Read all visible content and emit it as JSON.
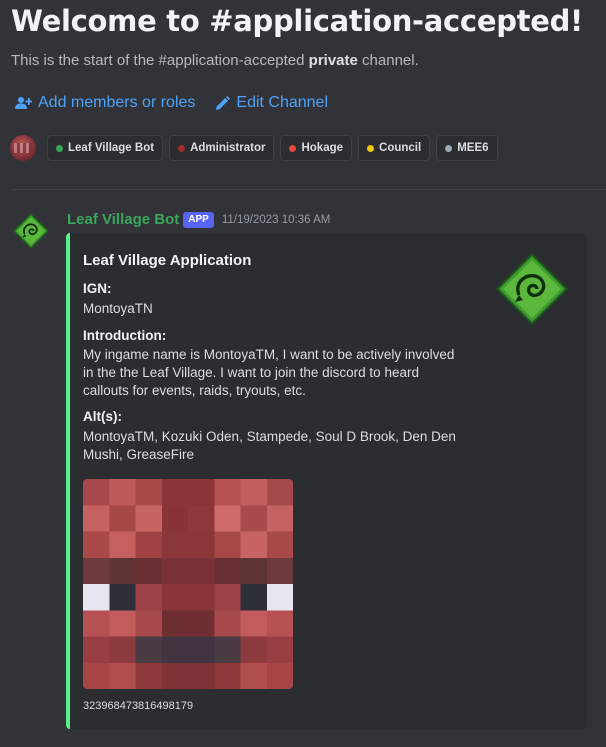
{
  "welcome": {
    "title": "Welcome to #application-accepted!",
    "subtitle_pre": "This is the start of the #application-accepted ",
    "subtitle_bold": "private",
    "subtitle_post": " channel."
  },
  "actions": {
    "add_members": "Add members or roles",
    "edit_channel": "Edit Channel"
  },
  "roles": [
    {
      "label": "Leaf Village Bot",
      "color": "#3ba55c"
    },
    {
      "label": "Administrator",
      "color": "#a12d2f"
    },
    {
      "label": "Hokage",
      "color": "#e34c3b"
    },
    {
      "label": "Council",
      "color": "#f1c40f"
    },
    {
      "label": "MEE6",
      "color": "#99aab5"
    }
  ],
  "message": {
    "author": "Leaf Village Bot",
    "badge": "APP",
    "timestamp": "11/19/2023 10:36 AM",
    "author_color": "#3ba55c",
    "embed": {
      "accent_color": "#57f287",
      "title": "Leaf Village Application",
      "fields": [
        {
          "name": "IGN:",
          "value": "MontoyaTN"
        },
        {
          "name": "Introduction:",
          "value": "My ingame name is MontoyaTM, I want to be actively involved in the the Leaf Village. I want to join the discord to heard callouts for events, raids, tryouts, etc."
        },
        {
          "name": "Alt(s):",
          "value": "MontoyaTM, Kozuki Oden, Stampede, Soul D Brook, Den Den Mushi, GreaseFire"
        }
      ],
      "thumbnail_icon": "leaf-village-emblem-icon",
      "image_icon": "pixelated-minecraft-skin-face",
      "footer": "323968473816498179"
    }
  }
}
